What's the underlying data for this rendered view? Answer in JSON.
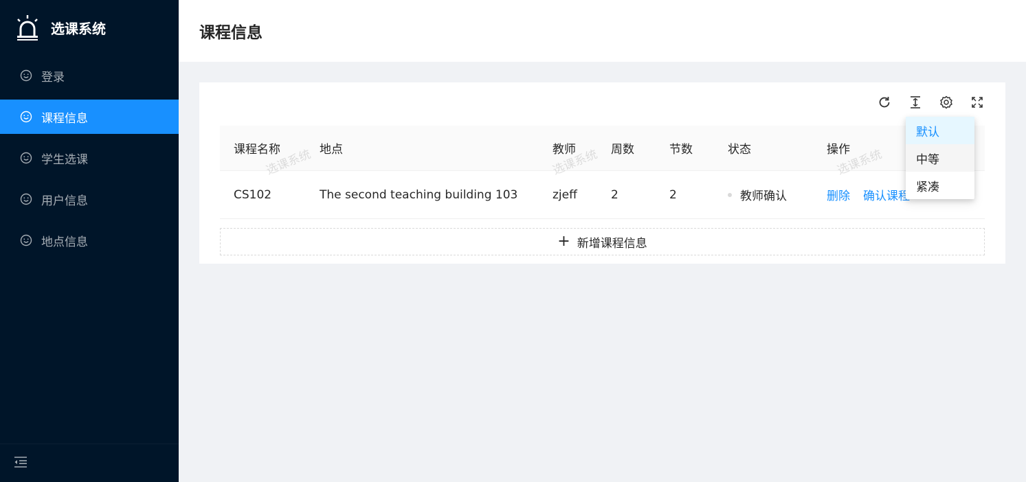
{
  "app": {
    "title": "选课系统"
  },
  "sidebar": {
    "items": [
      {
        "label": "登录",
        "active": false
      },
      {
        "label": "课程信息",
        "active": true
      },
      {
        "label": "学生选课",
        "active": false
      },
      {
        "label": "用户信息",
        "active": false
      },
      {
        "label": "地点信息",
        "active": false
      }
    ]
  },
  "header": {
    "title": "课程信息"
  },
  "table": {
    "columns": [
      "课程名称",
      "地点",
      "教师",
      "周数",
      "节数",
      "状态",
      "操作"
    ],
    "rows": [
      {
        "name": "CS102",
        "location": "The second teaching building 103",
        "teacher": "zjeff",
        "weeks": "2",
        "sections": "2",
        "status": "教师确认",
        "actions": [
          "删除",
          "确认课程"
        ]
      }
    ]
  },
  "add_button": {
    "label": "新增课程信息"
  },
  "watermark": "选课系统",
  "density_menu": {
    "options": [
      "默认",
      "中等",
      "紧凑"
    ],
    "selected": "默认"
  },
  "colors": {
    "sider": "#001529",
    "accent": "#1890ff"
  }
}
